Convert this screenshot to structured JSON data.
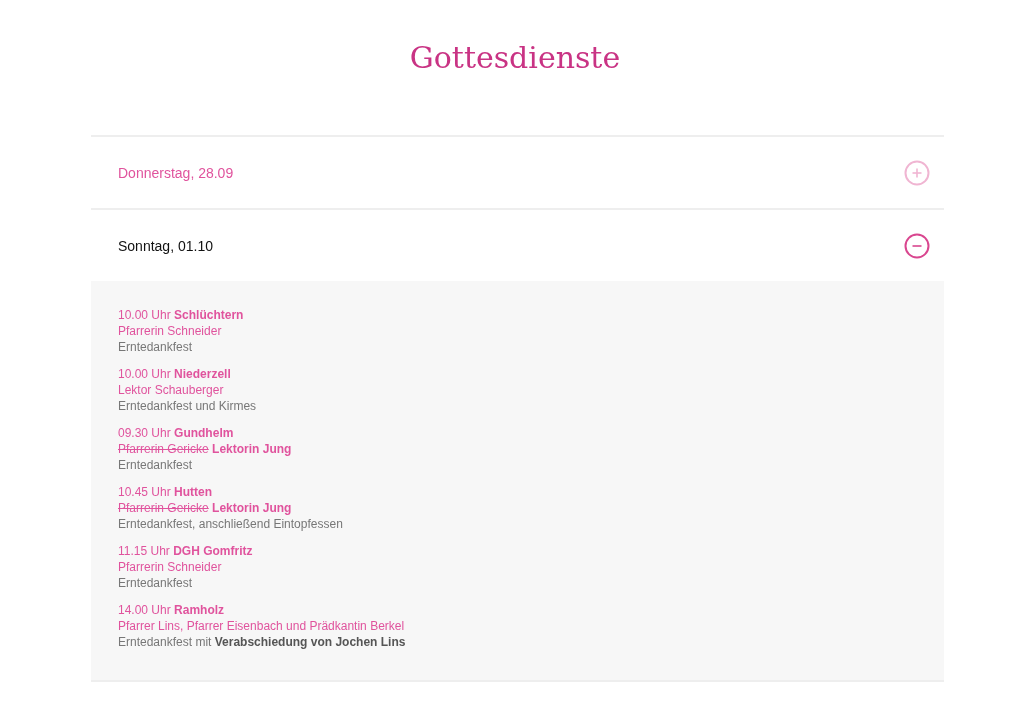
{
  "title": "Gottesdienste",
  "days": [
    {
      "label": "Donnerstag, 28.09",
      "expanded": false
    },
    {
      "label": "Sonntag, 01.10",
      "expanded": true,
      "services": [
        {
          "when": "10.00 Uhr **Schlüchtern**",
          "officiant": "Pfarrerin Schneider",
          "note": "Erntedankfest"
        },
        {
          "when": "10.00 Uhr **Niederzell**",
          "officiant": "Lektor Schauberger",
          "note": "Erntedankfest und Kirmes"
        },
        {
          "when": "09.30 Uhr **Gundhelm**",
          "officiant_struck": "Pfarrerin Gericke",
          "officiant": "Lektorin Jung",
          "note": "Erntedankfest"
        },
        {
          "when": "10.45 Uhr **Hutten**",
          "officiant_struck": "Pfarrerin Gericke",
          "officiant": "Lektorin Jung",
          "note": "Erntedankfest, anschließend Eintopfessen"
        },
        {
          "when": "11.15 Uhr **DGH Gomfritz**",
          "officiant": "Pfarrerin Schneider",
          "note": "Erntedankfest"
        },
        {
          "when": "14.00 Uhr **Ramholz**",
          "officiant": "Pfarrer Lins, Pfarrer Eisenbach und Prädkantin Berkel",
          "note": "Erntedankfest mit **Verabschiedung von Jochen Lins**"
        }
      ]
    }
  ]
}
